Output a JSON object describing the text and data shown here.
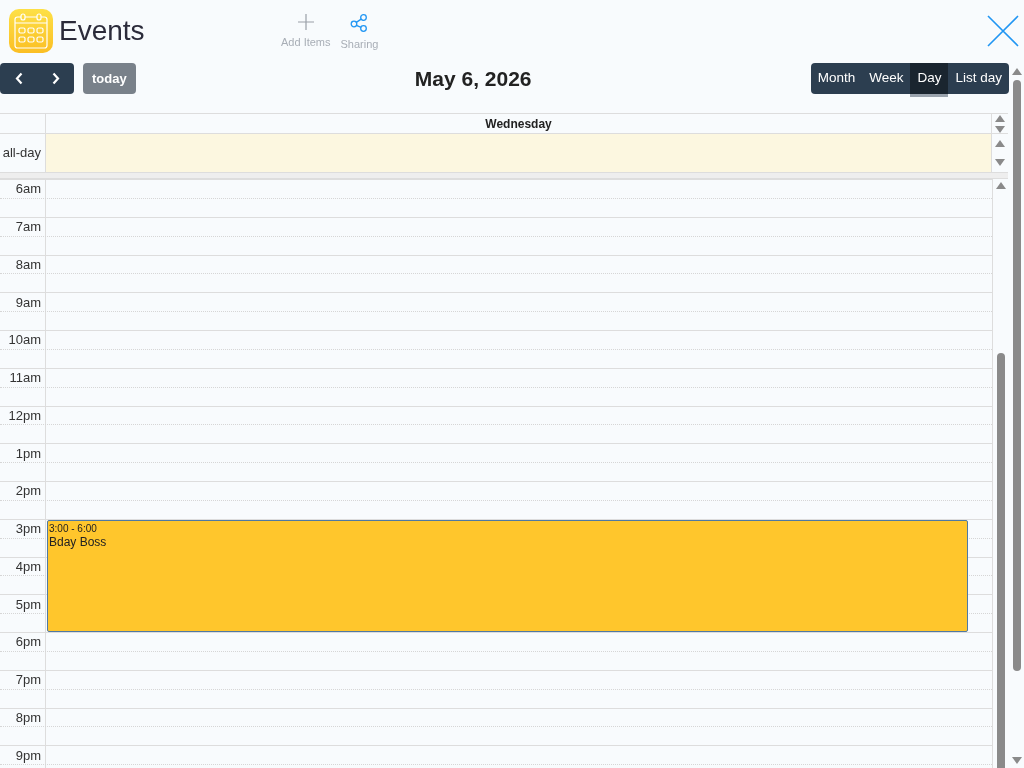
{
  "app": {
    "title": "Events",
    "actions": [
      {
        "kind": "add",
        "label": "Add Items"
      },
      {
        "kind": "share",
        "label": "Sharing"
      }
    ]
  },
  "toolbar": {
    "today": "today",
    "title": "May 6, 2026",
    "views": [
      {
        "label": "Month",
        "selected": false
      },
      {
        "label": "Week",
        "selected": false
      },
      {
        "label": "Day",
        "selected": true
      },
      {
        "label": "List day",
        "selected": false
      }
    ]
  },
  "calendar": {
    "day_header": "Wednesday",
    "all_day_label": "all-day",
    "hours": [
      {
        "label": "6am"
      },
      {
        "label": "7am"
      },
      {
        "label": "8am"
      },
      {
        "label": "9am"
      },
      {
        "label": "10am"
      },
      {
        "label": "11am"
      },
      {
        "label": "12pm"
      },
      {
        "label": "1pm"
      },
      {
        "label": "2pm"
      },
      {
        "label": "3pm",
        "events": [
          {
            "time": "3:00 - 6:00",
            "title": "Bday Boss"
          }
        ]
      },
      {
        "label": "4pm"
      },
      {
        "label": "5pm"
      },
      {
        "label": "6pm"
      },
      {
        "label": "7pm"
      },
      {
        "label": "8pm"
      },
      {
        "label": "9pm"
      }
    ]
  }
}
